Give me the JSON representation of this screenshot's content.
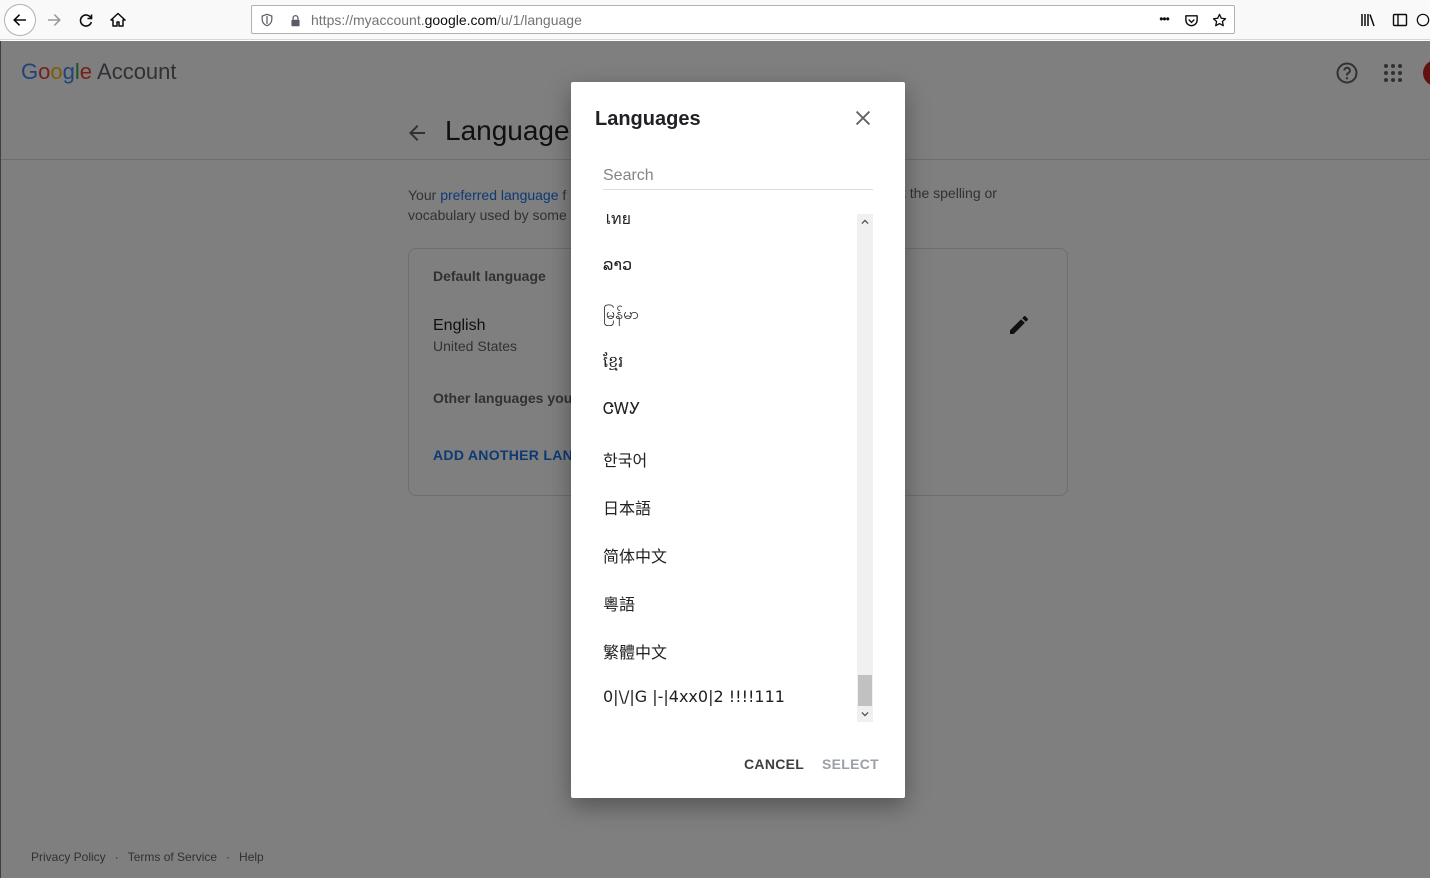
{
  "browser": {
    "url_prefix": "https://myaccount.",
    "url_host": "google.com",
    "url_path": "/u/1/language",
    "more_icon": "•••"
  },
  "header": {
    "brand": [
      "G",
      "o",
      "o",
      "g",
      "l",
      "e"
    ],
    "brand_suffix": "Account"
  },
  "page": {
    "title": "Language",
    "intro_start": "Your ",
    "intro_link": "preferred language",
    "intro_mid": " f",
    "intro_line2": "vocabulary used by some",
    "intro_right": "t the spelling or",
    "card": {
      "default_label": "Default language",
      "language": "English",
      "region": "United States",
      "other_label": "Other languages you",
      "add_button": "ADD ANOTHER LANG"
    }
  },
  "footer": {
    "privacy": "Privacy Policy",
    "terms": "Terms of Service",
    "help": "Help",
    "separator": "·"
  },
  "dialog": {
    "title": "Languages",
    "search_placeholder": "Search",
    "languages": [
      "ไทย",
      "ລາວ",
      "မြန်မာ",
      "ខ្មែរ",
      "ᏣᎳᎩ",
      "한국어",
      "日本語",
      "简体中文",
      "粵語",
      "繁體中文",
      "0|\\/|G |-|4xx0|2 !!!!111"
    ],
    "cancel": "CANCEL",
    "select": "SELECT"
  }
}
